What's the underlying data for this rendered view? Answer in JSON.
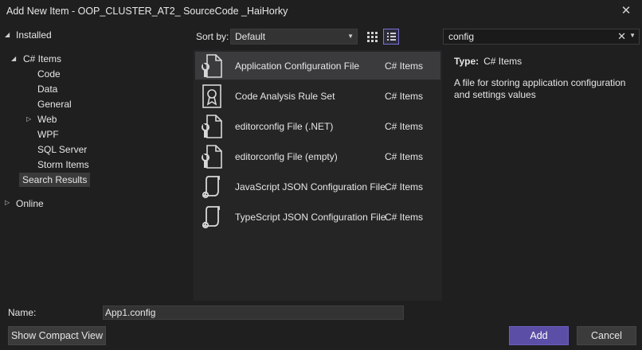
{
  "window": {
    "title": "Add New Item - OOP_CLUSTER_AT2_ SourceCode _HaiHorky"
  },
  "tree": {
    "installed": "Installed",
    "csharp_items": "C# Items",
    "children": [
      "Code",
      "Data",
      "General",
      "Web",
      "WPF",
      "SQL Server",
      "Storm Items"
    ],
    "search_results": "Search Results",
    "online": "Online"
  },
  "toolbar": {
    "sort_label": "Sort by:",
    "sort_value": "Default",
    "grid_view_icon": "grid-view-icon",
    "list_view_icon": "list-view-icon"
  },
  "search": {
    "value": "config"
  },
  "results": [
    {
      "name": "Application Configuration File",
      "category": "C# Items",
      "icon": "config-file-icon",
      "selected": true
    },
    {
      "name": "Code Analysis Rule Set",
      "category": "C# Items",
      "icon": "ruleset-icon"
    },
    {
      "name": "editorconfig File (.NET)",
      "category": "C# Items",
      "icon": "config-file-icon"
    },
    {
      "name": "editorconfig File (empty)",
      "category": "C# Items",
      "icon": "config-file-icon"
    },
    {
      "name": "JavaScript JSON Configuration File",
      "category": "C# Items",
      "icon": "json-config-icon"
    },
    {
      "name": "TypeScript JSON Configuration File",
      "category": "C# Items",
      "icon": "json-config-icon"
    }
  ],
  "details": {
    "type_label": "Type:",
    "type_value": "C# Items",
    "description": "A file for storing application configuration and settings values"
  },
  "bottom": {
    "name_label": "Name:",
    "name_value": "App1.config",
    "compact_button": "Show Compact View",
    "add_button": "Add",
    "cancel_button": "Cancel"
  },
  "colors": {
    "accent": "#5b4ea6",
    "background": "#1f1f1f",
    "selection": "#3b3b3d"
  }
}
